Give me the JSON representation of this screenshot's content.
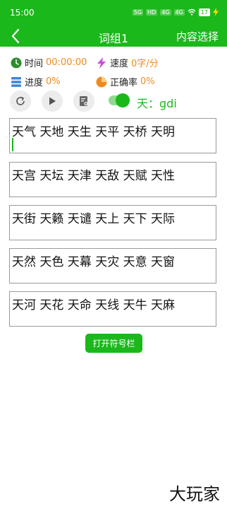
{
  "status_bar": {
    "time": "15:00",
    "indicators": [
      "5G",
      "HD",
      "4G",
      "4G"
    ],
    "battery": "17"
  },
  "app_bar": {
    "title": "词组1",
    "action": "内容选择"
  },
  "stats": {
    "time_label": "时间",
    "time_value": "00:00:00",
    "speed_label": "速度",
    "speed_value": "0字/分",
    "progress_label": "进度",
    "progress_value": "0%",
    "accuracy_label": "正确率",
    "accuracy_value": "0%"
  },
  "controls": {
    "toggle_on": true,
    "prompt": "天：gdi"
  },
  "groups": [
    "天气 天地 天生 天平 天桥 天明",
    "天宫 天坛 天津 天敌 天赋 天性",
    "天街 天籁 天谴 天上 天下 天际",
    "天然 天色 天幕 天灾 天意 天窗",
    "天河 天花 天命 天线 天牛 天麻"
  ],
  "open_symbol_bar": "打开符号栏",
  "watermark": "大玩家",
  "colors": {
    "primary": "#1bb81b",
    "value_orange": "#f08a1c",
    "speed_icon": "#c84fd8",
    "progress_icon": "#3a86d8",
    "accuracy_icon": "#f08a1c"
  }
}
